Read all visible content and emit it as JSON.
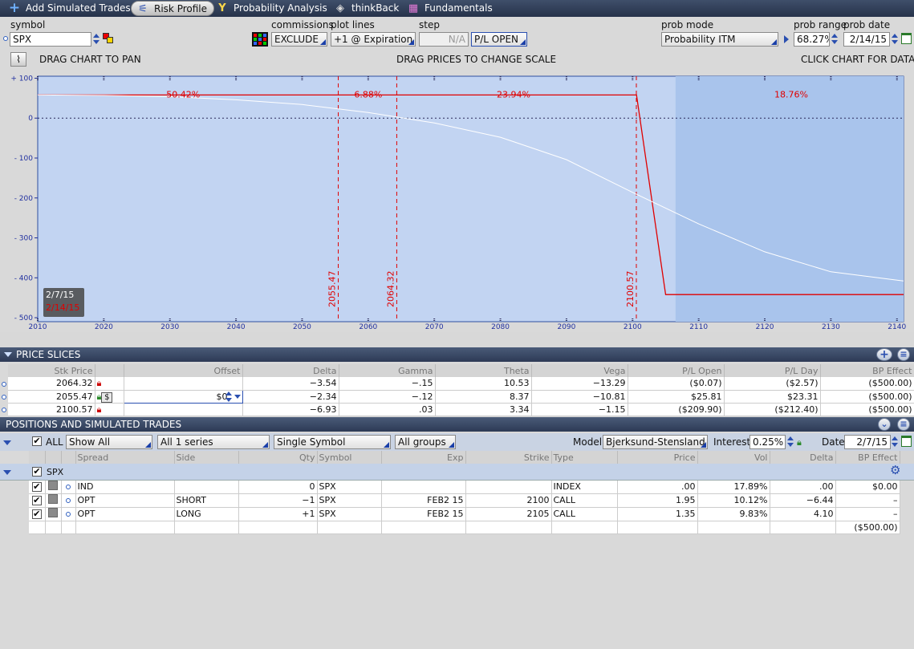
{
  "tabs": [
    {
      "label": "Add Simulated Trades",
      "icon": "plus-icon"
    },
    {
      "label": "Risk Profile",
      "icon": "risk-profile-icon"
    },
    {
      "label": "Probability Analysis",
      "icon": "probability-icon"
    },
    {
      "label": "thinkBack",
      "icon": "thinkback-icon"
    },
    {
      "label": "Fundamentals",
      "icon": "fundamentals-icon"
    }
  ],
  "controls": {
    "symbol_label": "symbol",
    "symbol_value": "SPX",
    "commissions_label": "commissions",
    "commissions_value": "EXCLUDE",
    "plot_lines_label": "plot lines",
    "plot_lines_value": "+1 @ Expiration",
    "step_label": "step",
    "step_value": "N/A",
    "pl_mode_value": "P/L OPEN",
    "prob_mode_label": "prob mode",
    "prob_mode_value": "Probability ITM",
    "prob_range_label": "prob range",
    "prob_range_value": "68.27%",
    "prob_date_label": "prob date",
    "prob_date_value": "2/14/15",
    "drag_pan": "DRAG CHART TO PAN",
    "drag_prices": "DRAG PRICES TO CHANGE SCALE",
    "click_chart": "CLICK CHART FOR DATA"
  },
  "chart_data": {
    "type": "line",
    "x_ticks": [
      2010,
      2020,
      2030,
      2040,
      2050,
      2060,
      2070,
      2080,
      2090,
      2100,
      2110,
      2120,
      2130,
      2140
    ],
    "y_ticks": [
      "+ 100",
      "0",
      "- 100",
      "- 200",
      "- 300",
      "- 400",
      "- 500"
    ],
    "y_tick_values": [
      100,
      0,
      -100,
      -200,
      -300,
      -400,
      -500
    ],
    "xlim": [
      2010,
      2141
    ],
    "ylim": [
      -510,
      105
    ],
    "series": [
      {
        "x": [
          2010,
          2100.6,
          2105,
          2141
        ],
        "y": [
          58,
          58,
          -442,
          -442
        ],
        "color": "#e00000"
      },
      {
        "x": [
          2010,
          2020,
          2030,
          2040,
          2050,
          2060,
          2070,
          2080,
          2090,
          2100,
          2110,
          2120,
          2130,
          2141
        ],
        "y": [
          58,
          57,
          54,
          46,
          34,
          14,
          -12,
          -48,
          -104,
          -186,
          -265,
          -335,
          -385,
          -408
        ],
        "color": "#ffffff"
      }
    ],
    "strike_lines": [
      {
        "value": 2055.47,
        "label": "2055.47"
      },
      {
        "value": 2064.32,
        "label": "2064.32"
      },
      {
        "value": 2100.57,
        "label": "2100.57"
      }
    ],
    "probability_bands": [
      {
        "label": "50.42%",
        "x": 2032
      },
      {
        "label": "6.88%",
        "x": 2060
      },
      {
        "label": "23.94%",
        "x": 2082
      },
      {
        "label": "18.76%",
        "x": 2124
      }
    ],
    "shaded_from": 2106.5,
    "date_current": "2/7/15",
    "date_future": "2/14/15",
    "colors": {
      "plot_bg": "#c2d4f2",
      "shade": "#a9c4ec",
      "line": "#e00000"
    }
  },
  "price_slices": {
    "title": "PRICE SLICES",
    "headers": [
      "Stk Price",
      "Offset",
      "Delta",
      "Gamma",
      "Theta",
      "Vega",
      "P/L Open",
      "P/L Day",
      "BP Effect"
    ],
    "rows": [
      {
        "price": "2064.32",
        "offset": "",
        "delta": "−3.54",
        "gamma": "−.15",
        "theta": "10.53",
        "vega": "−13.29",
        "pl_open": "($0.07)",
        "pl_day": "($2.57)",
        "bp": "($500.00)"
      },
      {
        "price": "2055.47",
        "offset": "$0",
        "delta": "−2.34",
        "gamma": "−.12",
        "theta": "8.37",
        "vega": "−10.81",
        "pl_open": "$25.81",
        "pl_day": "$23.31",
        "bp": "($500.00)"
      },
      {
        "price": "2100.57",
        "offset": "",
        "delta": "−6.93",
        "gamma": ".03",
        "theta": "3.34",
        "vega": "−1.15",
        "pl_open": "($209.90)",
        "pl_day": "($212.40)",
        "bp": "($500.00)"
      }
    ]
  },
  "positions": {
    "title": "POSITIONS AND SIMULATED TRADES",
    "all_label": "ALL",
    "show_filter": "Show All",
    "series_filter": "All 1 series",
    "symbol_filter": "Single Symbol",
    "groups_filter": "All groups",
    "model_label": "Model",
    "model_value": "Bjerksund-Stensland",
    "interest_label": "Interest",
    "interest_value": "0.25%",
    "date_label": "Date",
    "date_value": "2/7/15",
    "headers": [
      "Spread",
      "Side",
      "Qty",
      "Symbol",
      "Exp",
      "Strike",
      "Type",
      "Price",
      "Vol",
      "Delta",
      "BP Effect"
    ],
    "group_symbol": "SPX",
    "rows": [
      {
        "spread": "IND",
        "side": "",
        "qty": "0",
        "symbol": "SPX",
        "exp": "",
        "strike": "",
        "type": "INDEX",
        "price": ".00",
        "vol": "17.89%",
        "delta": ".00",
        "bp": "$0.00"
      },
      {
        "spread": "OPT",
        "side": "SHORT",
        "qty": "−1",
        "symbol": "SPX",
        "exp": "FEB2 15",
        "strike": "2100",
        "type": "CALL",
        "price": "1.95",
        "vol": "10.12%",
        "delta": "−6.44",
        "bp": "–"
      },
      {
        "spread": "OPT",
        "side": "LONG",
        "qty": "+1",
        "symbol": "SPX",
        "exp": "FEB2 15",
        "strike": "2105",
        "type": "CALL",
        "price": "1.35",
        "vol": "9.83%",
        "delta": "4.10",
        "bp": "–"
      }
    ],
    "total_bp": "($500.00)"
  }
}
